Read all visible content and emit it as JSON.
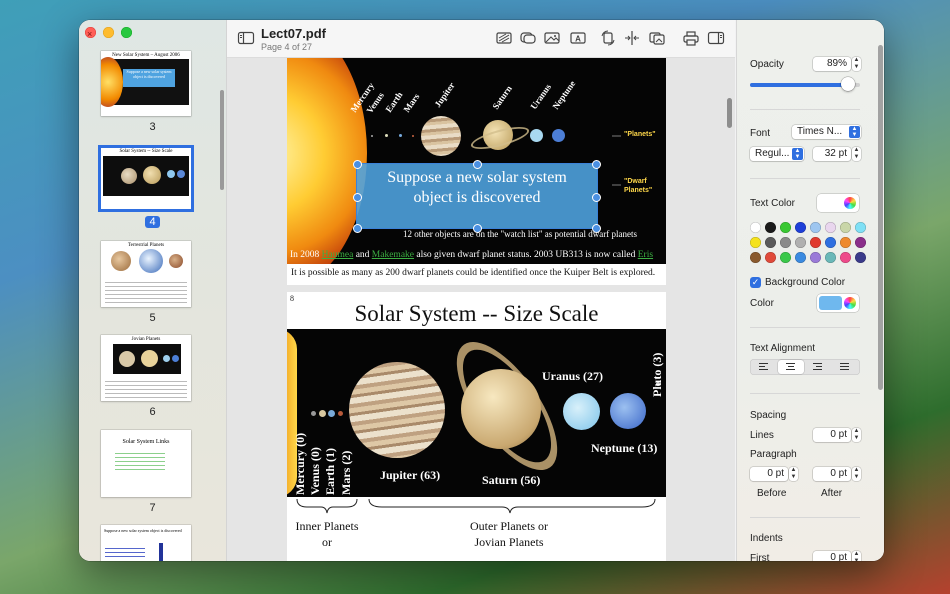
{
  "window": {
    "title": "Lect07.pdf",
    "subtitle": "Page 4 of 27"
  },
  "sidebar": {
    "thumbnails": [
      {
        "page": "3",
        "heading": "New Solar System – August 2006",
        "caption": "Suppose a new solar system object is discovered"
      },
      {
        "page": "4",
        "heading": "Solar System -- Size Scale",
        "selected": true
      },
      {
        "page": "5",
        "heading": "Terrestrial Planets"
      },
      {
        "page": "6",
        "heading": "Jovian Planets"
      },
      {
        "page": "7",
        "heading": "Solar System Links"
      },
      {
        "page": "",
        "heading": "Suppose a new solar system object is discovered"
      }
    ]
  },
  "toolbar": {
    "icons": [
      "sidebar-toggle-icon",
      "select-region-icon",
      "speech-bubble-icon",
      "image-icon",
      "text-box-icon",
      "rotate-icon",
      "split-icon",
      "copy-pages-icon",
      "print-icon",
      "inspector-toggle-icon"
    ]
  },
  "page_prev": {
    "planet_labels": [
      "Mercury",
      "Venus",
      "Earth",
      "Mars",
      "Jupiter",
      "Saturn",
      "Uranus",
      "Neptune"
    ],
    "planets_tag": "\"Planets\"",
    "dwarf_tag": "\"Dwarf Planets\"",
    "annotation": "Suppose a new solar system object is discovered",
    "watchlist": "12 other objects are on the \"watch list\" as potential dwarf planets",
    "line1_a": "In 2008",
    "line1_link1": "Haumea",
    "line1_b": "and",
    "line1_link2": "Makemake",
    "line1_c": "also given dwarf planet status.  2003 UB313 is now called",
    "line1_link3": "Eris",
    "line2": "It is possible as many as 200 dwarf planets could be identified once the Kuiper Belt is explored."
  },
  "page_current": {
    "number": "8",
    "title": "Solar System -- Size Scale",
    "labels": {
      "mercury": "Mercury (0)",
      "venus": "Venus (0)",
      "earth": "Earth (1)",
      "mars": "Mars (2)",
      "jupiter": "Jupiter (63)",
      "saturn": "Saturn (56)",
      "uranus": "Uranus (27)",
      "neptune": "Neptune (13)",
      "pluto": "Pluto (3)"
    },
    "inner_a": "Inner Planets",
    "inner_b": "or",
    "outer_a": "Outer Planets or",
    "outer_b": "Jovian Planets"
  },
  "inspector": {
    "opacity_label": "Opacity",
    "opacity_value": "89%",
    "opacity_fraction": 0.89,
    "font_label": "Font",
    "font_family": "Times N...",
    "font_style": "Regul...",
    "font_size": "32 pt",
    "text_color_label": "Text Color",
    "swatches": [
      "#ffffff",
      "#1a1a1a",
      "#39c832",
      "#1e3fd8",
      "#9ec6f0",
      "#e9d6ee",
      "#c9d6a8",
      "#7fe0f5",
      "#f5e21c",
      "#5a5a5a",
      "#8a8a8a",
      "#b0b0b0",
      "#e03a2e",
      "#2f6fe0",
      "#ee8a2e",
      "#8a2e8a",
      "#8a5a2e",
      "#e04a3a",
      "#3ac84a",
      "#3a8ae0",
      "#9a7ad8",
      "#6ab8b8",
      "#ee4a8a",
      "#3a3a8a"
    ],
    "bg_checkbox_label": "Background Color",
    "bg_checked": true,
    "color_label": "Color",
    "bg_color": "#6fb8ee",
    "alignment_label": "Text Alignment",
    "alignment_selected": "center",
    "spacing_label": "Spacing",
    "lines_label": "Lines",
    "lines_value": "0 pt",
    "paragraph_label": "Paragraph",
    "before_value": "0 pt",
    "after_value": "0 pt",
    "before_label": "Before",
    "after_label": "After",
    "indents_label": "Indents",
    "first_label": "First",
    "first_value": "0 pt"
  },
  "colors": {
    "accent": "#2f6fe0",
    "annotation_fill": "#4fa3e0"
  }
}
